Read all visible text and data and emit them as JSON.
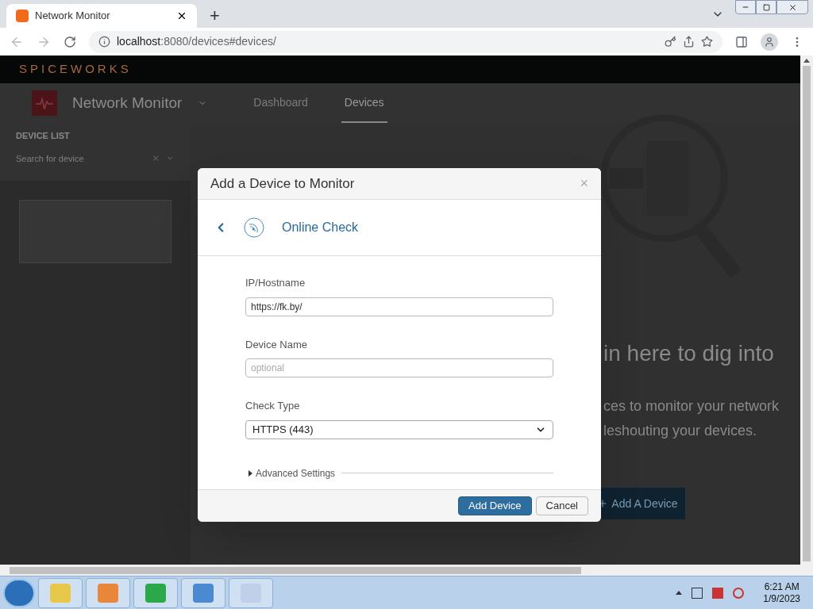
{
  "browser": {
    "tab_title": "Network Monitor",
    "new_tab": "+",
    "url_host": "localhost",
    "url_rest": ":8080/devices#devices/"
  },
  "app": {
    "logo": "SPICEWORKS",
    "title": "Network Monitor",
    "nav": [
      {
        "label": "Dashboard",
        "selected": false
      },
      {
        "label": "Devices",
        "selected": true
      }
    ],
    "sidebar": {
      "heading": "DEVICE LIST",
      "search_placeholder": "Search for device"
    },
    "background": {
      "headline": "in here to dig into",
      "line_1": "ces to monitor your network",
      "line_2": "leshouting your devices.",
      "button": "Add A Device"
    }
  },
  "dialog": {
    "title": "Add a Device to Monitor",
    "close": "×",
    "step": "Online Check",
    "fields": [
      {
        "kind": "text",
        "label": "IP/Hostname",
        "value": "https://fk.by/"
      },
      {
        "kind": "text",
        "label": "Device Name",
        "placeholder": "optional"
      },
      {
        "kind": "select",
        "label": "Check Type",
        "value": "HTTPS (443)"
      }
    ],
    "advanced": {
      "label": "Advanced Settings",
      "expanded": false
    },
    "buttons": [
      {
        "label": "Add Device",
        "kind": "primary"
      },
      {
        "label": "Cancel",
        "kind": "default"
      }
    ]
  },
  "taskbar": {
    "time": "6:21 AM",
    "date": "1/9/2023"
  }
}
